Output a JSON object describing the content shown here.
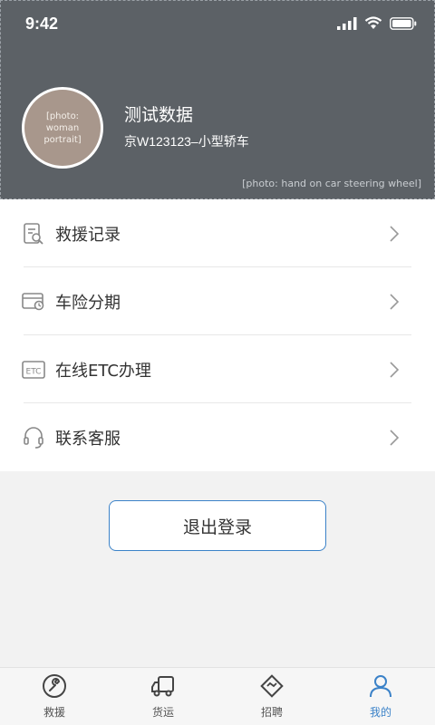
{
  "status_bar": {
    "time": "9:42"
  },
  "header": {
    "background_caption": "[photo: hand on car steering wheel]",
    "avatar_caption": "[photo: woman portrait]",
    "user_name": "测试数据",
    "plate_vehicle": "京W123123–小型轿车"
  },
  "menu": {
    "items": [
      {
        "label": "救援记录",
        "icon": "rescue-record-icon"
      },
      {
        "label": "车险分期",
        "icon": "insurance-card-icon"
      },
      {
        "label": "在线ETC办理",
        "icon": "etc-icon"
      },
      {
        "label": "联系客服",
        "icon": "headset-icon"
      }
    ]
  },
  "logout_label": "退出登录",
  "tabbar": {
    "active_index": 3,
    "active_color": "#3b82c8",
    "tabs": [
      {
        "label": "救援",
        "icon": "wrench-icon"
      },
      {
        "label": "货运",
        "icon": "truck-icon"
      },
      {
        "label": "招聘",
        "icon": "handshake-icon"
      },
      {
        "label": "我的",
        "icon": "user-icon"
      }
    ]
  }
}
